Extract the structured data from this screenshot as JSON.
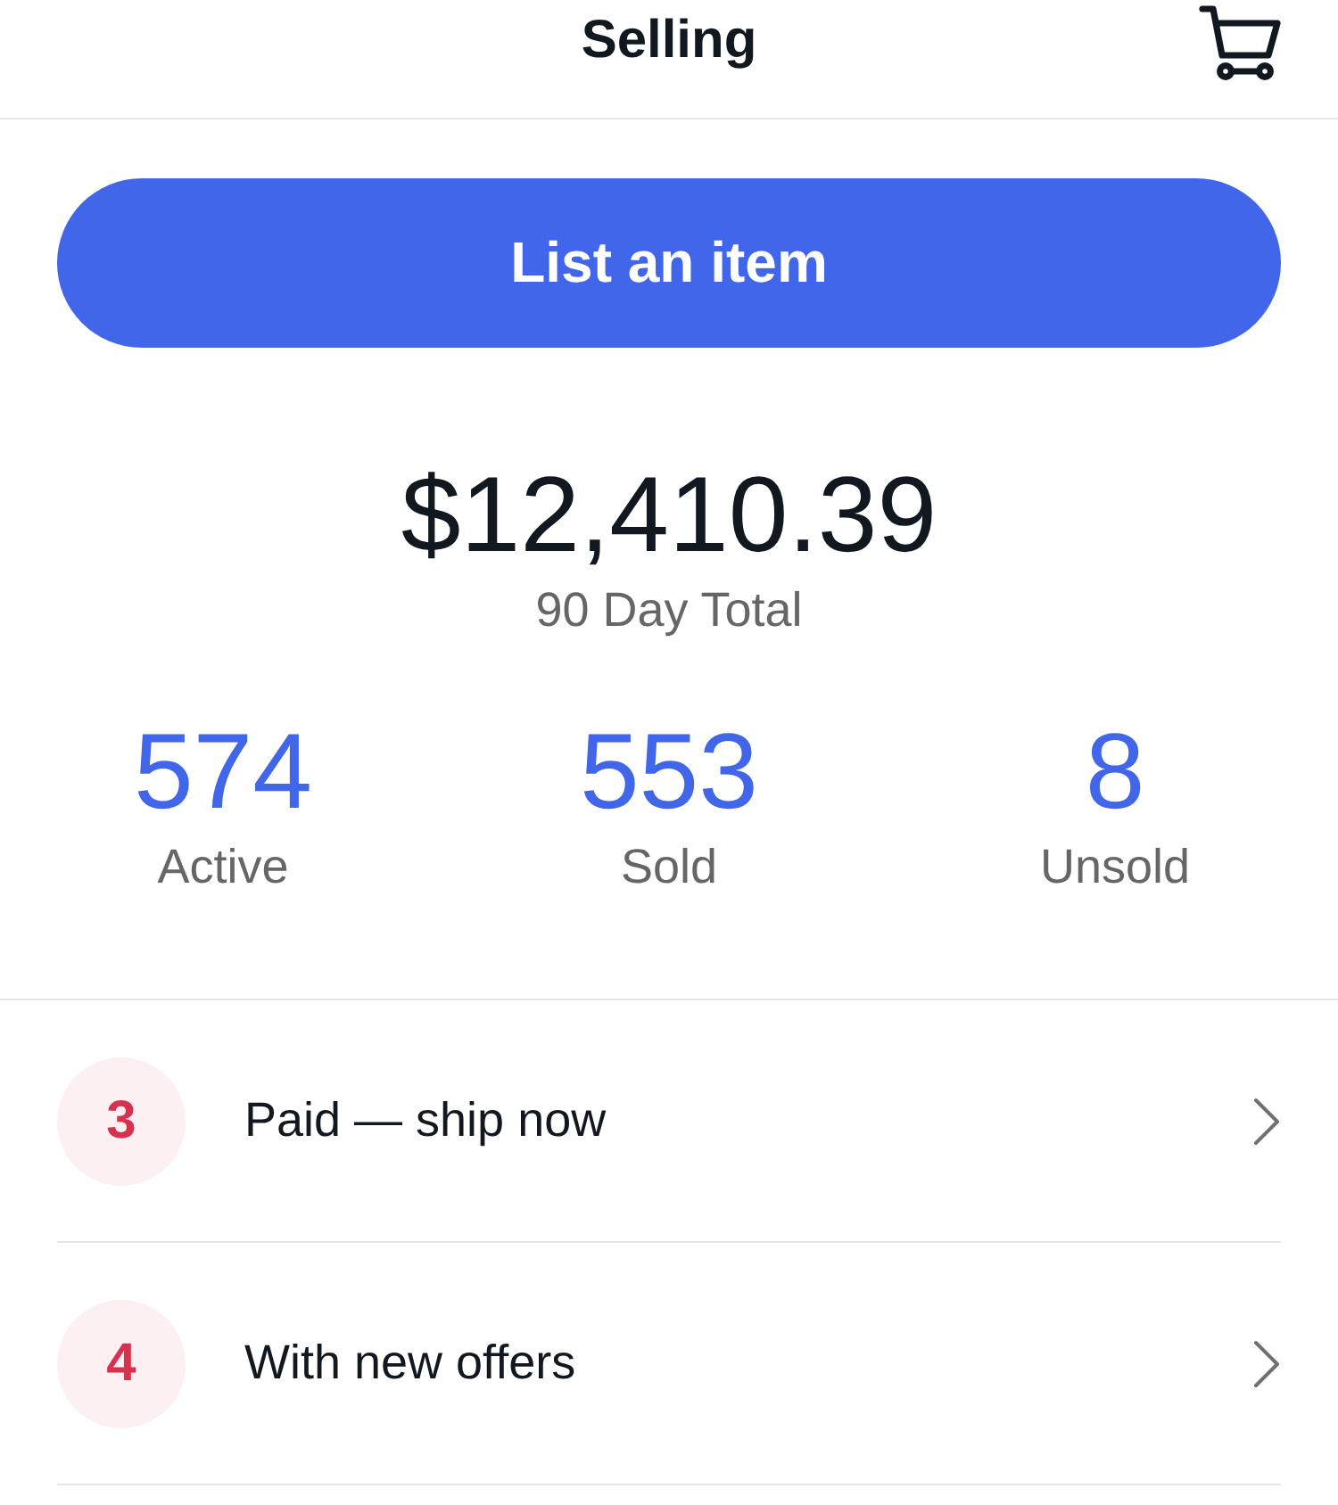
{
  "header": {
    "title": "Selling"
  },
  "list_button": {
    "label": "List an item"
  },
  "total": {
    "amount": "$12,410.39",
    "label": "90 Day Total"
  },
  "stats": [
    {
      "value": "574",
      "label": "Active"
    },
    {
      "value": "553",
      "label": "Sold"
    },
    {
      "value": "8",
      "label": "Unsold"
    }
  ],
  "tasks": [
    {
      "count": "3",
      "label": "Paid — ship now"
    },
    {
      "count": "4",
      "label": "With new offers"
    }
  ]
}
